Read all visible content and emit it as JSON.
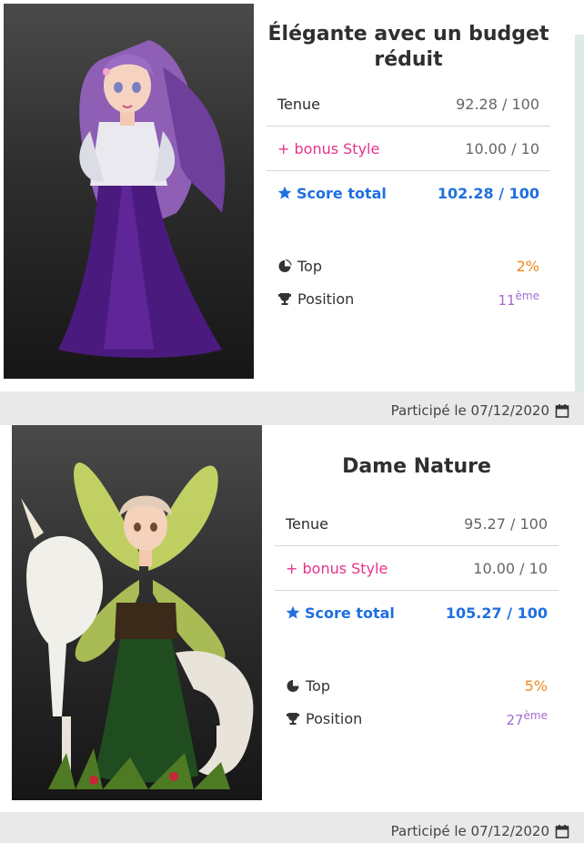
{
  "entries": [
    {
      "title": "Élégante avec un budget réduit",
      "scores": {
        "outfit_label": "Tenue",
        "outfit_value": "92.28 / 100",
        "bonus_label": "+ bonus Style",
        "bonus_value": "10.00 / 10",
        "total_label": "Score total",
        "total_value": "102.28 / 100"
      },
      "stats": {
        "top_label": "Top",
        "top_value": "2%",
        "position_label": "Position",
        "position_number": "11",
        "position_suffix": "ème"
      },
      "footer": "Participé le 07/12/2020",
      "colors": {
        "gown": "#4b1a7e",
        "hair": "#8e5fb5"
      }
    },
    {
      "title": "Dame Nature",
      "scores": {
        "outfit_label": "Tenue",
        "outfit_value": "95.27 / 100",
        "bonus_label": "+ bonus Style",
        "bonus_value": "10.00 / 10",
        "total_label": "Score total",
        "total_value": "105.27 / 100"
      },
      "stats": {
        "top_label": "Top",
        "top_value": "5%",
        "position_label": "Position",
        "position_number": "27",
        "position_suffix": "ème"
      },
      "footer": "Participé le 07/12/2020",
      "colors": {
        "gown": "#1f4d1f",
        "wings": "#d8ea6a"
      }
    }
  ],
  "icons": {
    "star": "star-icon",
    "top": "pie-chart-icon",
    "position": "trophy-icon",
    "calendar": "calendar-icon"
  },
  "accent_colors": {
    "blue": "#1f6fe0",
    "pink": "#e6338a",
    "orange": "#ee8a1c",
    "purple": "#a46ad1"
  }
}
